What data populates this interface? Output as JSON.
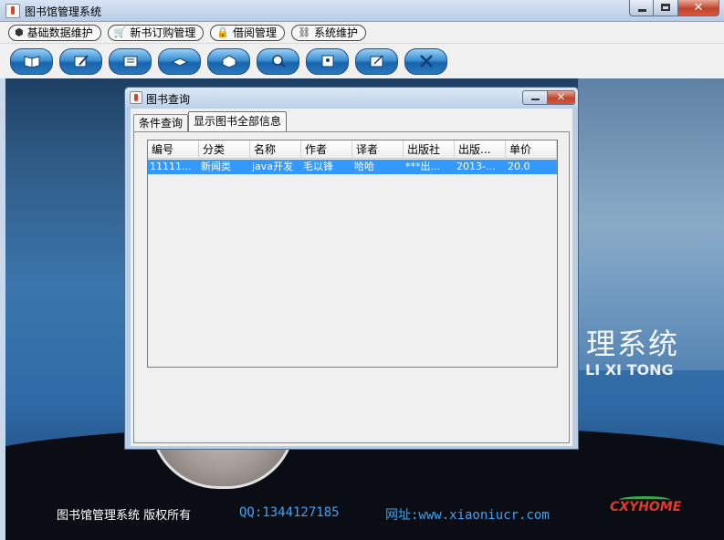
{
  "window": {
    "title": "图书馆管理系统"
  },
  "menu": [
    {
      "label": "基础数据维护",
      "icon": "cube-icon"
    },
    {
      "label": "新书订购管理",
      "icon": "cart-icon"
    },
    {
      "label": "借阅管理",
      "icon": "lock-icon"
    },
    {
      "label": "系统维护",
      "icon": "link-icon"
    }
  ],
  "toolbar": [
    {
      "icon": "book-icon"
    },
    {
      "icon": "pen-icon"
    },
    {
      "icon": "folder-icon"
    },
    {
      "icon": "open-book-icon"
    },
    {
      "icon": "box-icon"
    },
    {
      "icon": "magnifier-icon"
    },
    {
      "icon": "user-card-icon"
    },
    {
      "icon": "edit-card-icon"
    },
    {
      "icon": "exit-icon"
    }
  ],
  "dialog": {
    "title": "图书查询",
    "tabs": [
      "条件查询",
      "显示图书全部信息"
    ],
    "table": {
      "columns": [
        "编号",
        "分类",
        "名称",
        "作者",
        "译者",
        "出版社",
        "出版...",
        "单价"
      ],
      "rows": [
        [
          "11111...",
          "新闻类",
          "java开发",
          "毛以锋",
          "哈哈",
          "***出...",
          "2013-...",
          "20.0"
        ]
      ]
    }
  },
  "background": {
    "title": "理系统",
    "subtitle": "LI XI TONG",
    "footer_name": "图书馆管理系统  版权所有",
    "footer_qq": "QQ:1344127185",
    "footer_url": "网址:www.xiaoniucr.com",
    "logo": "CXYHOME"
  }
}
